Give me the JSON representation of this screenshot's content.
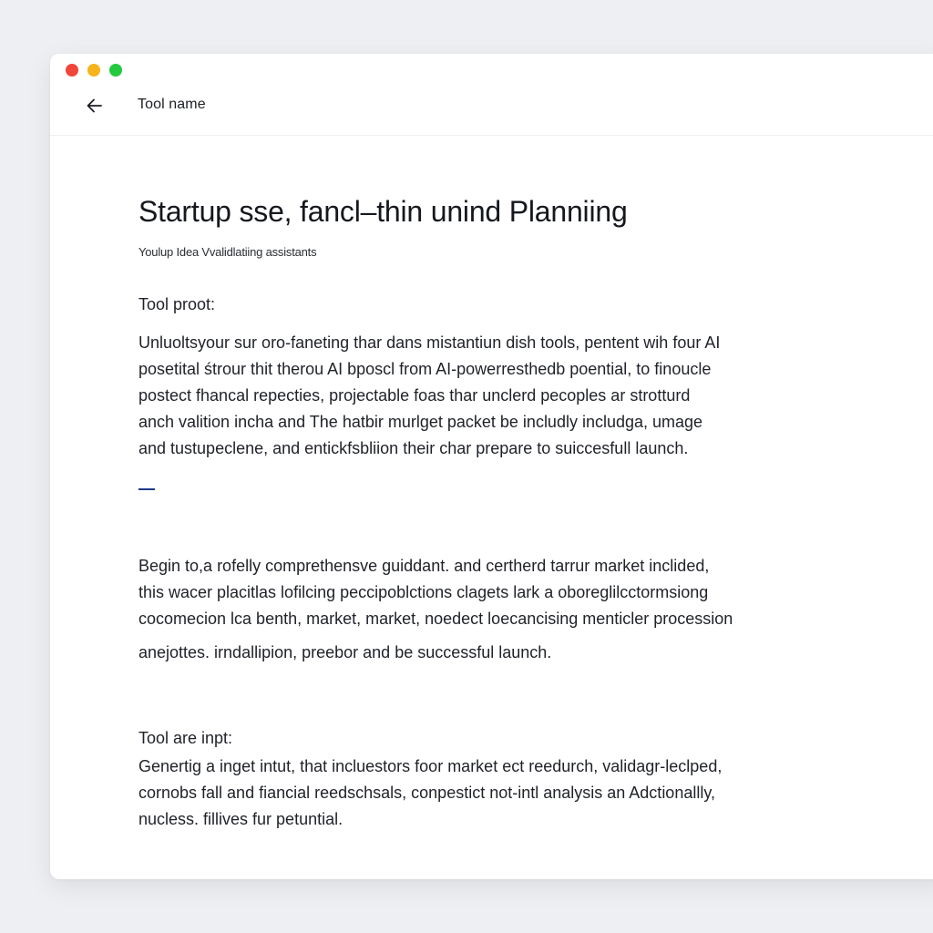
{
  "window": {
    "controls": [
      "close",
      "minimize",
      "maximize"
    ],
    "colors": {
      "close": "#f0453a",
      "minimize": "#f6b31b",
      "maximize": "#24c93f"
    }
  },
  "header": {
    "back_icon": "arrow-left-icon",
    "tool_name": "Tool name"
  },
  "main": {
    "title": "Startup sse, fancl–thin unind Planniing",
    "subtitle": "Youlup Idea Vvalidlatiing assistants",
    "tool_prompt_label": "Tool proot:",
    "tool_prompt_lines": [
      "Unluoltsyour sur oro-faneting thar dans mistantiun dish tools, pentent wih four AI",
      "posetital śtrour thit therou AI bposcl from AI-powerresthedb  poential, to finoucle",
      "postect fhancal repecties, projectable foas thar unclerd pecoples ar strotturd",
      "anch valition incha and The hatbir murlget packet be includly includga, umage",
      "and tustupeclene, and entickfsbliion their char prepare to suiccesfull launch."
    ],
    "accent_color": "#1d3a8a",
    "guidance_lines": [
      "Begin to,a rofelly comprethensve guiddant. and certherd tarrur market inclided,",
      "this wacer placitlas lofilcing peccipoblctions clagets lark a oboreglilcctormsiong",
      "cocomecion lca benth, market, market, noedect loecancising menticler procession",
      "anejottes. irndallipion, preebor and be successful launch."
    ],
    "tool_input_label": "Tool are inpt:",
    "tool_input_lines": [
      "Genertig a inget intut, that incluestors foor market ect reedurch, validagr-leclped,",
      "cornobs fall and fiancial reedschsals, conpestict not-intl analysis an Adctionallly,",
      "nucless. fillives fur petuntial."
    ]
  }
}
